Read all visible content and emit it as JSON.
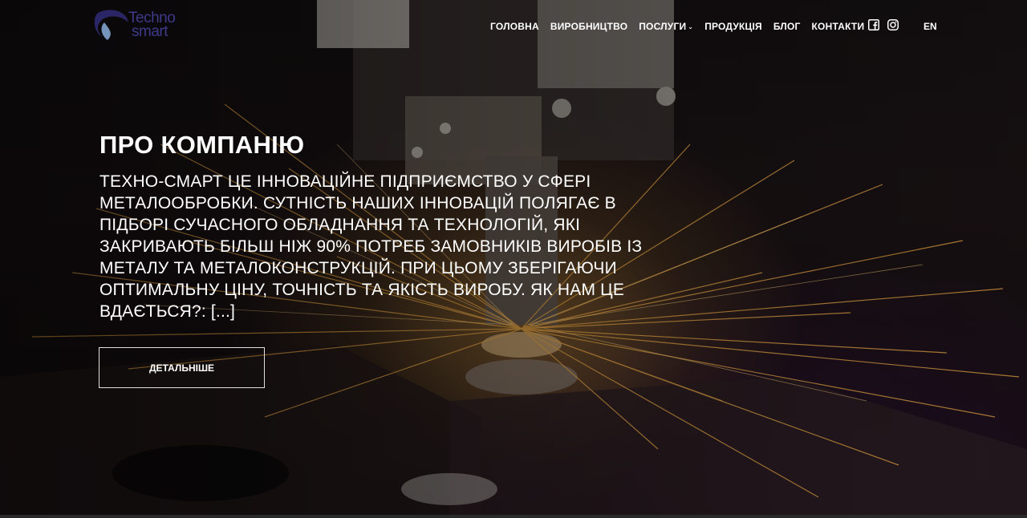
{
  "brand": {
    "logo_line1": "Techno",
    "logo_line2": "smart",
    "logo_color": "#3e3a8a"
  },
  "nav": {
    "items": [
      {
        "label": "ГОЛОВНА"
      },
      {
        "label": "ВИРОБНИЦТВО"
      },
      {
        "label": "ПОСЛУГИ",
        "has_dropdown": true
      },
      {
        "label": "ПРОДУКЦІЯ"
      },
      {
        "label": "БЛОГ"
      },
      {
        "label": "КОНТАКТИ"
      }
    ],
    "social": [
      "facebook-icon",
      "instagram-icon"
    ],
    "language": "EN"
  },
  "hero": {
    "title": "ПРО КОМПАНІЮ",
    "description": "ТЕХНО-СМАРТ ЦЕ ІННОВАЦІЙНЕ ПІДПРИЄМСТВО У СФЕРІ МЕТАЛООБРОБКИ. СУТНІСТЬ НАШИХ ІННОВАЦІЙ ПОЛЯГАЄ В ПІДБОРІ СУЧАСНОГО ОБЛАДНАННЯ ТА ТЕХНОЛОГІЙ, ЯКІ ЗАКРИВАЮТЬ БІЛЬШ НІЖ 90% ПОТРЕБ ЗАМОВНИКІВ ВИРОБІВ ІЗ МЕТАЛУ ТА МЕТАЛОКОНСТРУКЦІЙ. ПРИ ЦЬОМУ ЗБЕРІГАЮЧИ ОПТИМАЛЬНУ ЦІНУ,  ТОЧНІСТЬ ТА ЯКІСТЬ ВИРОБУ. ЯК НАМ ЦЕ ВДАЄТЬСЯ?: [...]",
    "button_label": "ДЕТАЛЬНІШЕ",
    "spark_color": "#e8a646"
  }
}
